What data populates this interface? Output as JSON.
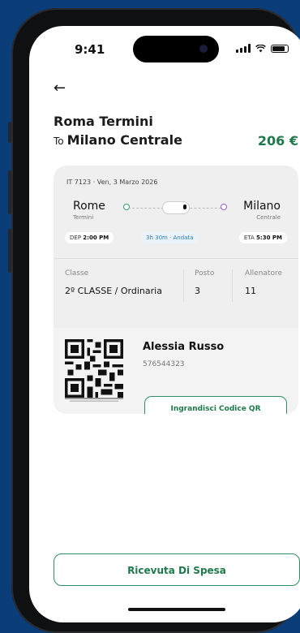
{
  "status": {
    "time": "9:41"
  },
  "route": {
    "from": "Roma Termini",
    "to_label": "To",
    "to": "Milano Centrale",
    "price": "206 €"
  },
  "trip": {
    "meta": "IT 7123 · Ven, 3 Marzo 2026",
    "origin": {
      "name": "Rome",
      "station": "Termini"
    },
    "destination": {
      "name": "Milano",
      "station": "Centrale"
    },
    "departure": {
      "label": "DEP",
      "time": "2:00 PM"
    },
    "duration": "3h 30m · Andata",
    "arrival": {
      "label": "ETA",
      "time": "5:30 PM"
    }
  },
  "details": {
    "class": {
      "label": "Classe",
      "value": "2º CLASSE / Ordinaria"
    },
    "seat": {
      "label": "Posto",
      "value": "3"
    },
    "coach": {
      "label": "Allenatore",
      "value": "11"
    }
  },
  "passenger": {
    "name": "Alessia Russo",
    "id": "576544323"
  },
  "actions": {
    "enlarge_qr": "Ingrandisci Codice QR",
    "receipt": "Ricevuta Di Spesa"
  },
  "icons": {
    "back": "arrow-left-icon",
    "qr": "qr-code-icon"
  },
  "colors": {
    "accent": "#1e7a4a",
    "background": "#0b3d78"
  }
}
